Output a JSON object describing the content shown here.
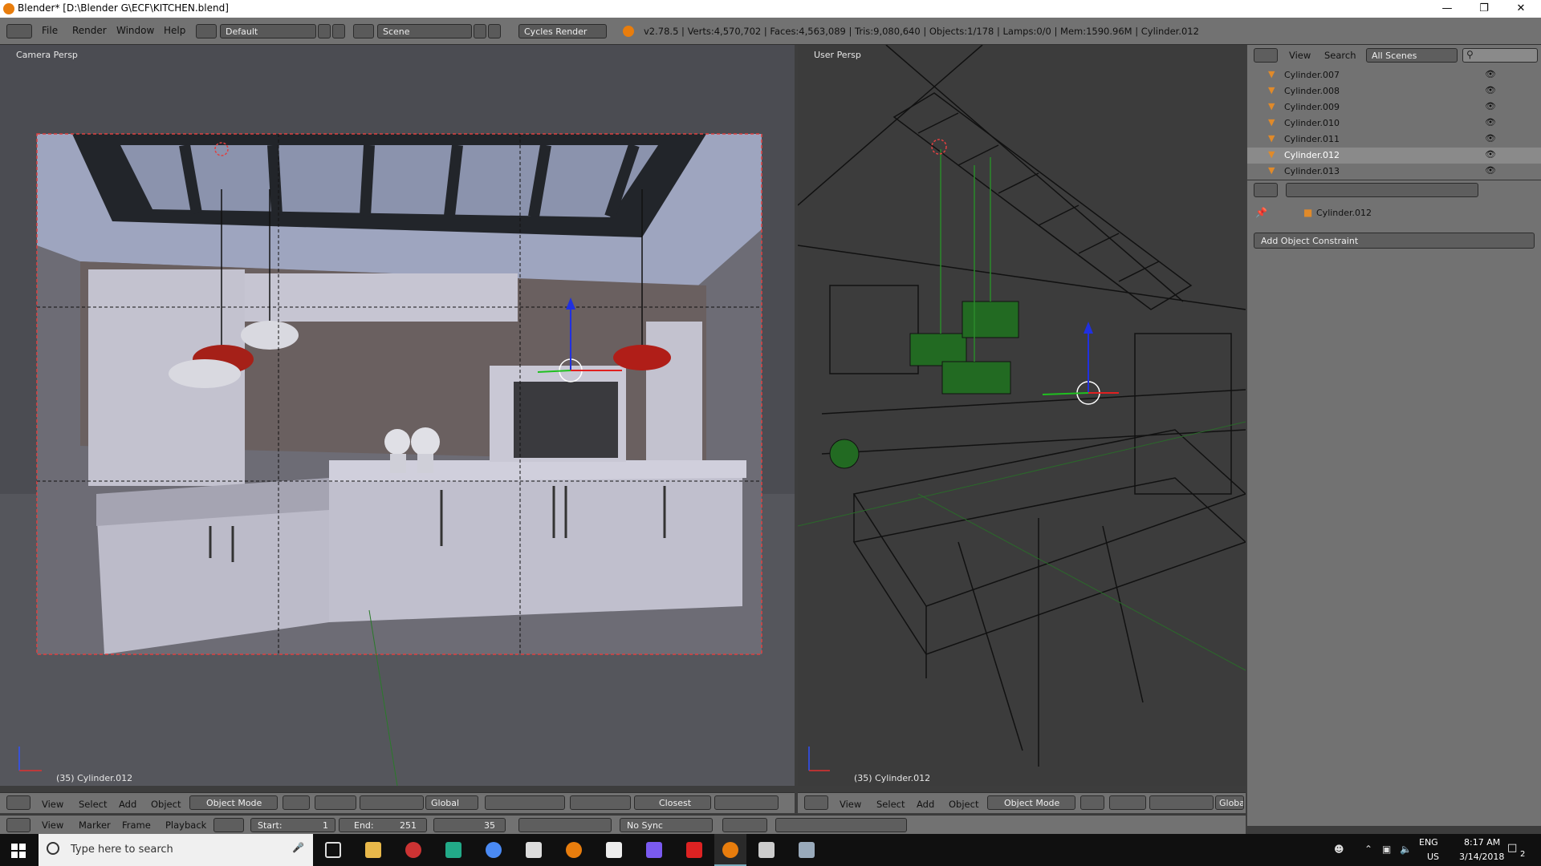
{
  "window": {
    "title": "Blender* [D:\\Blender G\\ECF\\KITCHEN.blend]"
  },
  "menus": [
    "File",
    "Render",
    "Window",
    "Help"
  ],
  "layout_field": "Default",
  "scene_field": "Scene",
  "render_engine": "Cycles Render",
  "stats": "v2.78.5 | Verts:4,570,702 | Faces:4,563,089 | Tris:9,080,640 | Objects:1/178 | Lamps:0/0 | Mem:1590.96M | Cylinder.012",
  "left_view": {
    "label": "Camera Persp",
    "object_label": "(35) Cylinder.012",
    "menus": [
      "View",
      "Select",
      "Add",
      "Object"
    ],
    "mode": "Object Mode",
    "orientation": "Global",
    "snap": "Closest"
  },
  "right_view": {
    "label": "User Persp",
    "object_label": "(35) Cylinder.012",
    "menus": [
      "View",
      "Select",
      "Add",
      "Object"
    ],
    "mode": "Object Mode",
    "orientation": "Globa"
  },
  "timeline": {
    "menus": [
      "View",
      "Marker",
      "Frame",
      "Playback"
    ],
    "start_label": "Start:",
    "start": "1",
    "end_label": "End:",
    "end": "251",
    "current": "35",
    "sync": "No Sync"
  },
  "outliner": {
    "menus": [
      "View",
      "Search"
    ],
    "filter": "All Scenes",
    "items": [
      {
        "name": "Cylinder.007",
        "selected": false
      },
      {
        "name": "Cylinder.008",
        "selected": false
      },
      {
        "name": "Cylinder.009",
        "selected": false
      },
      {
        "name": "Cylinder.010",
        "selected": false
      },
      {
        "name": "Cylinder.011",
        "selected": false
      },
      {
        "name": "Cylinder.012",
        "selected": true
      },
      {
        "name": "Cylinder.013",
        "selected": false
      }
    ]
  },
  "properties": {
    "object_name": "Cylinder.012",
    "add_constraint": "Add Object Constraint"
  },
  "taskbar": {
    "search_placeholder": "Type here to search",
    "language": "ENG",
    "region": "US",
    "time": "8:17 AM",
    "date": "3/14/2018",
    "notifications": "2"
  },
  "colors": {
    "accent": "#e87d0d",
    "selected_row": "#8a8a8a",
    "header": "#727272"
  }
}
